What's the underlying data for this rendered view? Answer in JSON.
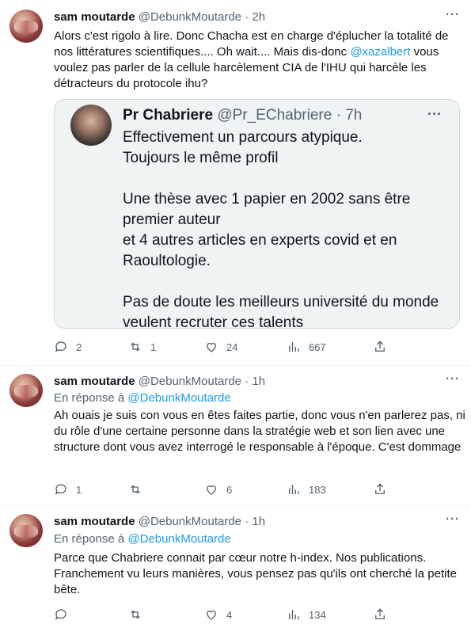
{
  "tweets": [
    {
      "name": "sam moutarde",
      "handle": "@DebunkMoutarde",
      "dot": "·",
      "time": "2h",
      "more": "···",
      "text_parts": {
        "before": "Alors c'est rigolo à lire. Donc Chacha est en charge d'éplucher la totalité de nos littératures scientifiques.... Oh wait.... Mais dis-donc ",
        "mention": "@xazalbert",
        "after": " vous voulez pas parler de la cellule harcèlement CIA de l'IHU qui harcèle les détracteurs du protocole ihu?"
      },
      "quote": {
        "name": "Pr Chabriere",
        "handle": "@Pr_EChabriere",
        "dot": "·",
        "time": "7h",
        "more": "···",
        "lines": [
          "Effectivement un parcours atypique.",
          "Toujours le même profil",
          "",
          "Une thèse avec 1 papier en 2002 sans être premier auteur",
          "et 4 autres articles en experts covid et en Raoultologie.",
          "",
          "Pas de doute les meilleurs université du monde veulent recruter ces talents"
        ]
      },
      "stats": {
        "replies": "2",
        "retweets": "1",
        "likes": "24",
        "views": "667"
      }
    },
    {
      "name": "sam moutarde",
      "handle": "@DebunkMoutarde",
      "dot": "·",
      "time": "1h",
      "more": "···",
      "reply_prefix": "En réponse à",
      "reply_to": "@DebunkMoutarde",
      "text": "Ah ouais je suis con vous en êtes faites partie, donc vous n'en parlerez pas, ni du rôle d'une certaine personne dans la stratégie web et son lien avec une structure dont vous avez interrogé le responsable à l'époque. C'est dommage",
      "stats": {
        "replies": "1",
        "retweets": "",
        "likes": "6",
        "views": "183"
      }
    },
    {
      "name": "sam moutarde",
      "handle": "@DebunkMoutarde",
      "dot": "·",
      "time": "1h",
      "more": "···",
      "reply_prefix": "En réponse à",
      "reply_to": "@DebunkMoutarde",
      "text": "Parce que Chabriere connait par cœur notre h-index. Nos publications. Franchement vu leurs manières, vous pensez pas qu'ils ont cherché la petite bête.",
      "stats": {
        "replies": "",
        "retweets": "",
        "likes": "4",
        "views": "134"
      }
    }
  ],
  "icons": {
    "reply": "reply-icon",
    "retweet": "retweet-icon",
    "like": "like-icon",
    "views": "views-icon",
    "share": "share-icon"
  },
  "colors": {
    "link": "#1d9bf0",
    "muted": "#536471",
    "text": "#0f1419",
    "quote_bg": "#eff3f4"
  }
}
